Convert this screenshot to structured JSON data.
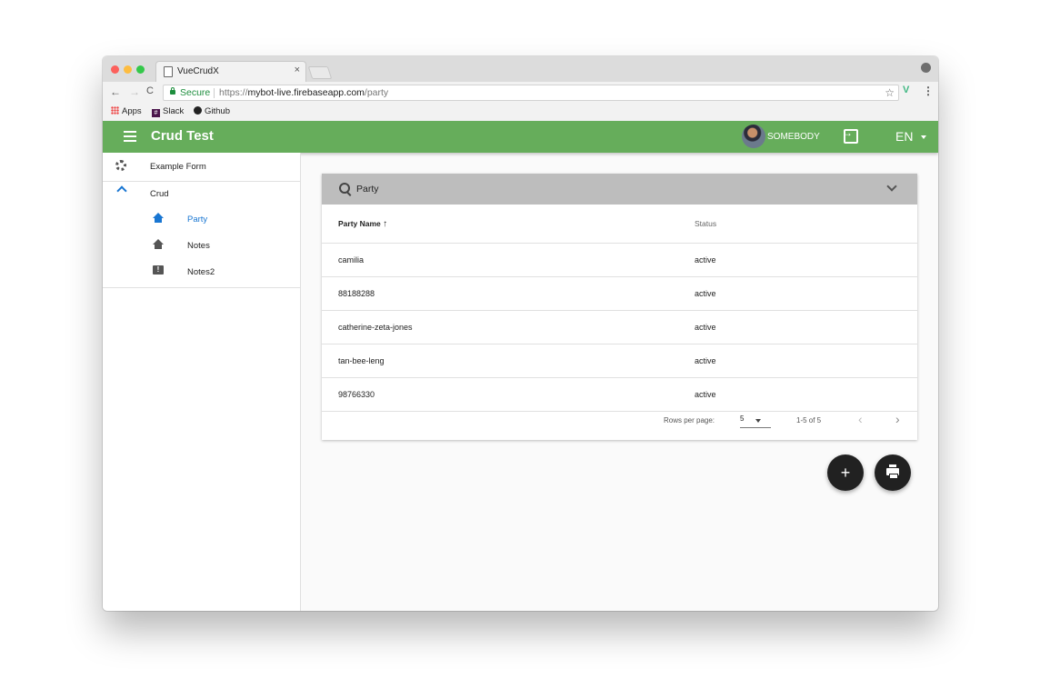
{
  "browser": {
    "tab_title": "VueCrudX",
    "tab_close": "×",
    "nav_back": "←",
    "nav_forward": "→",
    "nav_reload": "C",
    "secure_label": "Secure",
    "url_protocol": "https://",
    "url_host": "mybot-live.firebaseapp.com",
    "url_path": "/party",
    "star": "☆",
    "ext_label": "V",
    "kebab": "⋮",
    "bookmarks": [
      "Apps",
      "Slack",
      "Github"
    ]
  },
  "appbar": {
    "title": "Crud Test",
    "user_name": "SOMEBODY",
    "language": "EN",
    "color": "#66ad5b"
  },
  "sidebar": {
    "items": [
      {
        "label": "Example Form",
        "icon": "gear-icon"
      },
      {
        "label": "Crud",
        "icon": "chevron-up-icon"
      },
      {
        "label": "Party",
        "icon": "home-icon",
        "active": true
      },
      {
        "label": "Notes",
        "icon": "home-icon"
      },
      {
        "label": "Notes2",
        "icon": "feedback-icon"
      }
    ]
  },
  "filter": {
    "label": "Party"
  },
  "table": {
    "columns": [
      "Party Name",
      "Status"
    ],
    "sort_indicator": "↑",
    "rows": [
      [
        "camilia",
        "active"
      ],
      [
        "88188288",
        "active"
      ],
      [
        "catherine-zeta-jones",
        "active"
      ],
      [
        "tan-bee-leng",
        "active"
      ],
      [
        "98766330",
        "active"
      ]
    ]
  },
  "pagination": {
    "rows_per_page_label": "Rows per page:",
    "rows_per_page": "5",
    "range": "1-5 of 5",
    "prev": "‹",
    "next": "›"
  },
  "actions": {
    "add": "+"
  }
}
